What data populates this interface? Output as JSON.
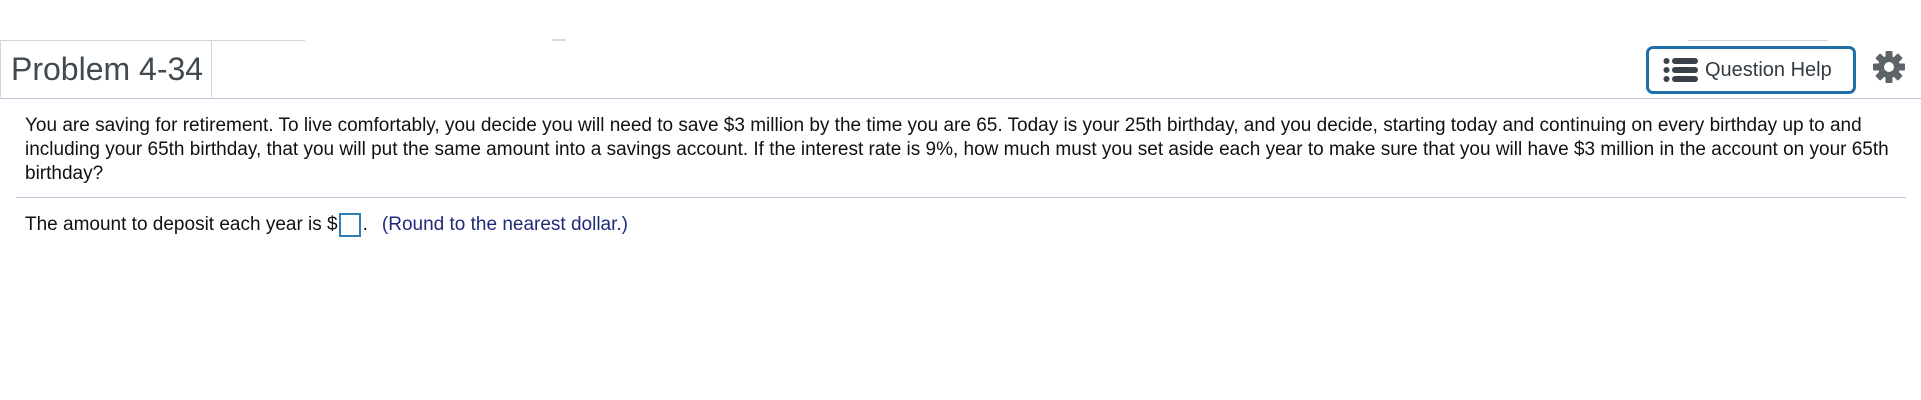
{
  "header": {
    "title": "Problem 4-34",
    "question_help_label": "Question Help",
    "question_help_icon": "list-icon",
    "settings_icon": "gear-icon"
  },
  "question": {
    "text": "You are saving for retirement. To live comfortably, you decide you will need to save $3 million by the time you are 65. Today is your 25th birthday, and you decide, starting today and continuing on every birthday up to and including your 65th birthday, that you will put the same amount into a savings account. If the interest rate is 9%, how much must you set aside each year to make sure that you will have $3 million in the account on your 65th birthday?"
  },
  "answer": {
    "prefix": "The amount to deposit each year is $",
    "value": "",
    "suffix": ".",
    "hint": "(Round to the nearest dollar.)"
  },
  "colors": {
    "accent": "#1f6fa8",
    "hint_text": "#1f2a7a",
    "divider": "#b8c8d8"
  }
}
